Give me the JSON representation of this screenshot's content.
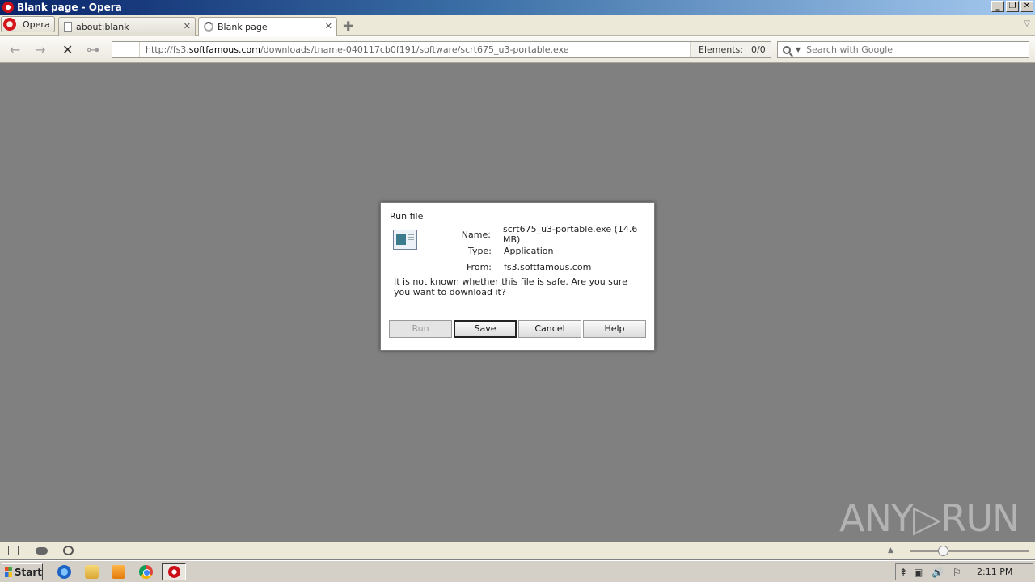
{
  "window": {
    "title": "Blank page - Opera",
    "buttons": [
      "_",
      "❐",
      "✕"
    ]
  },
  "menu": {
    "label": "Opera"
  },
  "tabs": [
    {
      "label": "about:blank",
      "close": "✕"
    },
    {
      "label": "Blank page",
      "close": "✕"
    }
  ],
  "new_tab": "✚",
  "tab_menu": "▽",
  "nav": {
    "back": "←",
    "forward": "→",
    "stop": "✕",
    "key": "⊶",
    "url_scheme": "http://fs3.",
    "url_domain": "softfamous.com",
    "url_path": "/downloads/tname-040117cb0f191/software/scrt675_u3-portable.exe",
    "elements_label": "Elements:",
    "elements_count": "0/0"
  },
  "search": {
    "dropdown": "▼",
    "placeholder": "Search with Google"
  },
  "dialog": {
    "title": "Run file",
    "name_key": "Name:",
    "name_val": "scrt675_u3-portable.exe (14.6 MB)",
    "type_key": "Type:",
    "type_val": "Application",
    "from_key": "From:",
    "from_val": "fs3.softfamous.com",
    "message": "It is not known whether this file is safe. Are you sure you want to download it?",
    "buttons": {
      "run": "Run",
      "save": "Save",
      "cancel": "Cancel",
      "help": "Help"
    }
  },
  "watermark": "ANY▷RUN",
  "statusbar": {
    "zoom_up": "▲"
  },
  "taskbar": {
    "start": "Start",
    "tray_icons": [
      "⇞",
      "▣",
      "🔊",
      "⚐"
    ],
    "clock": "2:11 PM"
  }
}
